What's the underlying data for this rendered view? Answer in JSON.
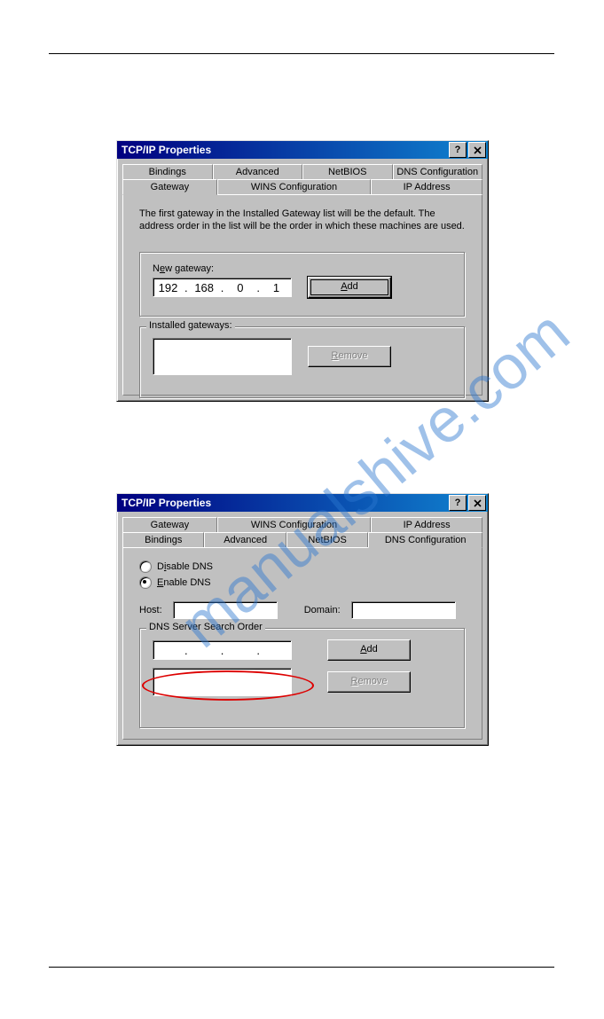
{
  "watermark": "manualshive.com",
  "dialog1": {
    "title": "TCP/IP Properties",
    "tabs_back": [
      "Bindings",
      "Advanced",
      "NetBIOS",
      "DNS Configuration"
    ],
    "tabs_front": [
      "Gateway",
      "WINS Configuration",
      "IP Address"
    ],
    "active_tab": "Gateway",
    "description": "The first gateway in the Installed Gateway list will be the default. The address order in the list will be the order in which these machines are used.",
    "new_gateway_label_pre": "N",
    "new_gateway_label_und": "e",
    "new_gateway_label_post": "w gateway:",
    "ip": [
      "192",
      "168",
      "0",
      "1"
    ],
    "add_und": "A",
    "add_post": "dd",
    "installed_legend": "Installed gateways:",
    "remove_und": "R",
    "remove_post": "emove"
  },
  "dialog2": {
    "title": "TCP/IP Properties",
    "tabs_back": [
      "Gateway",
      "WINS Configuration",
      "IP Address"
    ],
    "tabs_front": [
      "Bindings",
      "Advanced",
      "NetBIOS",
      "DNS Configuration"
    ],
    "active_tab": "DNS Configuration",
    "disable_pre": "D",
    "disable_und": "i",
    "disable_post": "sable DNS",
    "enable_und": "E",
    "enable_post": "nable DNS",
    "host_label": "Host:",
    "host_value": "",
    "domain_label": "Domain:",
    "domain_value": "",
    "dns_order_legend": "DNS Server Search Order",
    "dns_ip": [
      "",
      "",
      "",
      ""
    ],
    "add_und": "A",
    "add_post": "dd",
    "remove_und": "R",
    "remove_post": "emove"
  }
}
